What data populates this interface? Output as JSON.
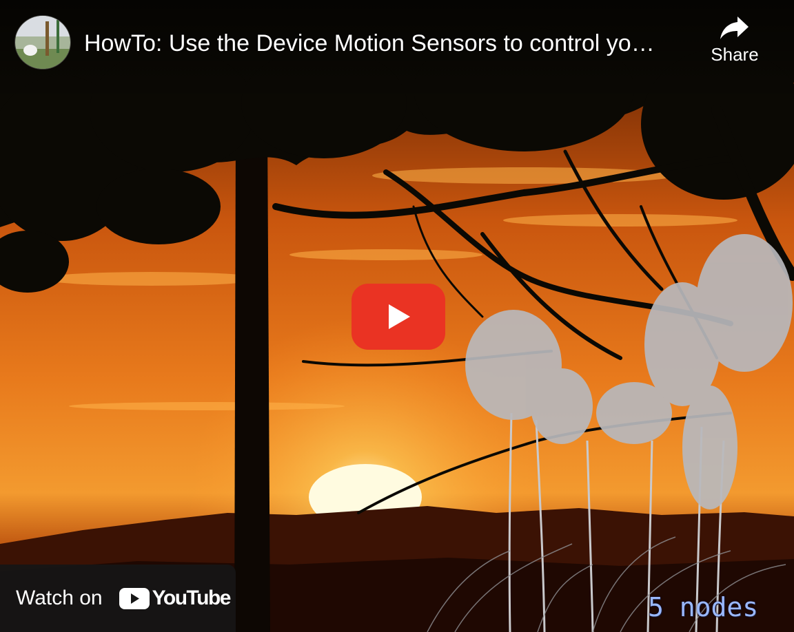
{
  "video": {
    "title": "HowTo: Use the Device Motion Sensors to control yo…",
    "channel_avatar_icon": "channel-avatar-icon"
  },
  "share": {
    "label": "Share",
    "icon": "share-arrow-icon"
  },
  "player": {
    "play_icon": "play-icon",
    "play_color": "#ea3323"
  },
  "watch_on": {
    "label": "Watch on",
    "brand": "YouTube",
    "icon": "youtube-logo-icon"
  },
  "thumbnail": {
    "watermark": "5 nodes"
  }
}
